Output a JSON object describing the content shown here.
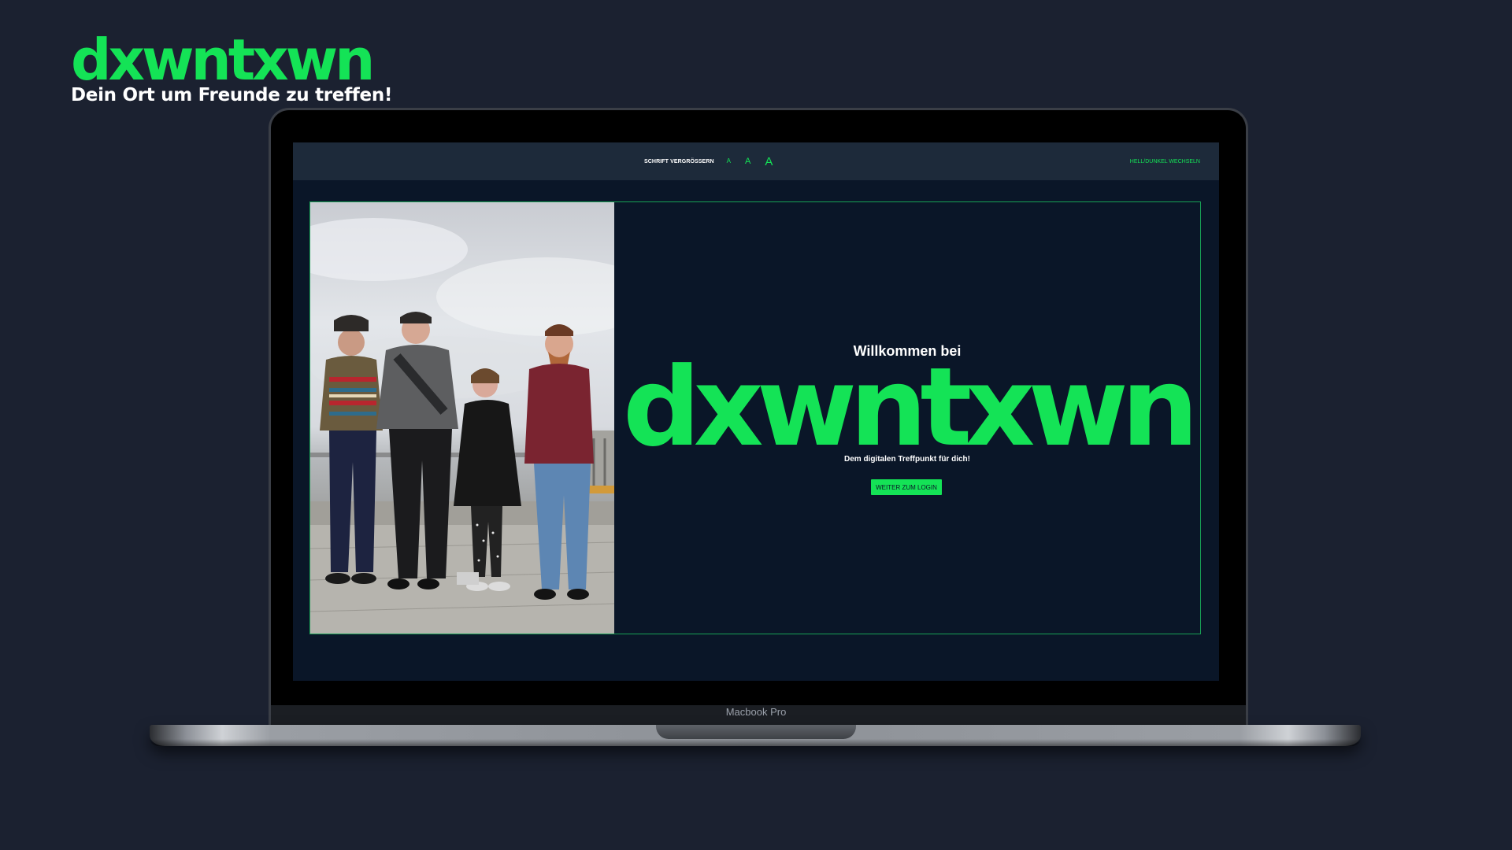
{
  "brand": {
    "logo": "dxwntxwn",
    "tagline": "Dein Ort um Freunde zu treffen!"
  },
  "device": {
    "label": "Macbook Pro"
  },
  "topbar": {
    "font_label": "SCHRIFT VERGRÖSSERN",
    "font_small": "A",
    "font_medium": "A",
    "font_large": "A",
    "theme_toggle": "HELL/DUNKEL WECHSELN"
  },
  "hero": {
    "welcome": "Willkommen bei",
    "logo": "dxwntxwn",
    "subtitle": "Dem digitalen Treffpunkt für dich!",
    "login_button": "WEITER ZUM LOGIN"
  },
  "colors": {
    "background": "#1b2130",
    "accent": "#14e356",
    "screen_bg": "#0a1628",
    "topbar_bg": "#1d2a3a"
  }
}
